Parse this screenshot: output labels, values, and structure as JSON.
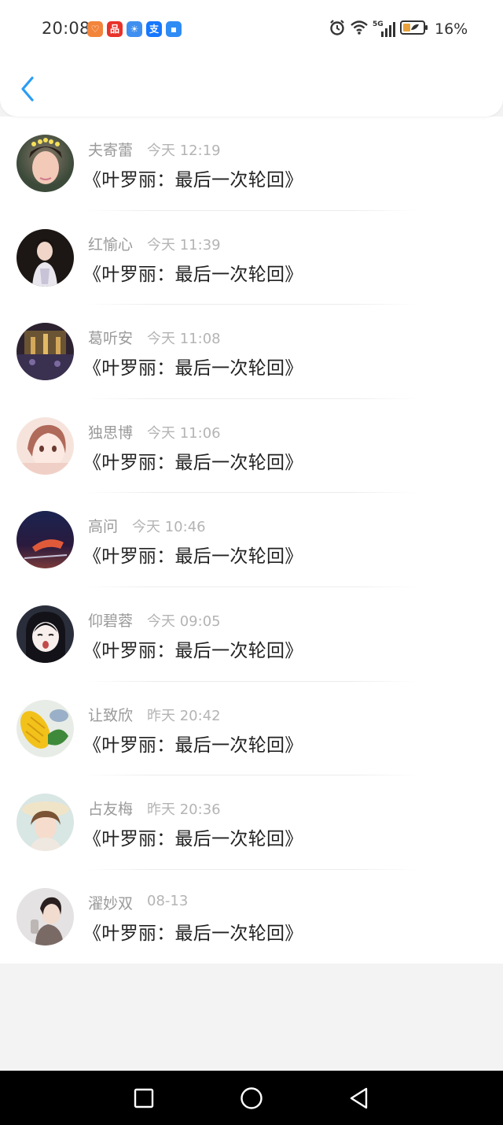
{
  "status_bar": {
    "time": "20:08",
    "network_label": "5G",
    "battery": "16%",
    "notification_icons": [
      {
        "name": "app-heart-icon",
        "color": "#f2853b",
        "glyph": "♡"
      },
      {
        "name": "app-red-icon",
        "color": "#e8322a",
        "glyph": "品"
      },
      {
        "name": "app-weather-icon",
        "color": "#3f8ff0",
        "glyph": "☀"
      },
      {
        "name": "app-alipay-icon",
        "color": "#1677ff",
        "glyph": "支"
      },
      {
        "name": "app-blue-icon",
        "color": "#2f8cf5",
        "glyph": "▪"
      }
    ]
  },
  "header": {
    "back_icon": "chevron-left-icon",
    "accent_color": "#2a9df4"
  },
  "items": [
    {
      "name": "夫寄蕾",
      "time": "今天 12:19",
      "message": "《叶罗丽：最后一次轮回》"
    },
    {
      "name": "红愉心",
      "time": "今天 11:39",
      "message": "《叶罗丽：最后一次轮回》"
    },
    {
      "name": "葛听安",
      "time": "今天 11:08",
      "message": "《叶罗丽：最后一次轮回》"
    },
    {
      "name": "独思博",
      "time": "今天 11:06",
      "message": "《叶罗丽：最后一次轮回》"
    },
    {
      "name": "高问",
      "time": "今天 10:46",
      "message": "《叶罗丽：最后一次轮回》"
    },
    {
      "name": "仰碧蓉",
      "time": "今天 09:05",
      "message": "《叶罗丽：最后一次轮回》"
    },
    {
      "name": "让致欣",
      "time": "昨天 20:42",
      "message": "《叶罗丽：最后一次轮回》"
    },
    {
      "name": "占友梅",
      "time": "昨天 20:36",
      "message": "《叶罗丽：最后一次轮回》"
    },
    {
      "name": "濯妙双",
      "time": "08-13",
      "message": "《叶罗丽：最后一次轮回》"
    }
  ],
  "nav": {
    "recent_icon": "square-icon",
    "home_icon": "circle-icon",
    "back_icon": "triangle-back-icon"
  }
}
